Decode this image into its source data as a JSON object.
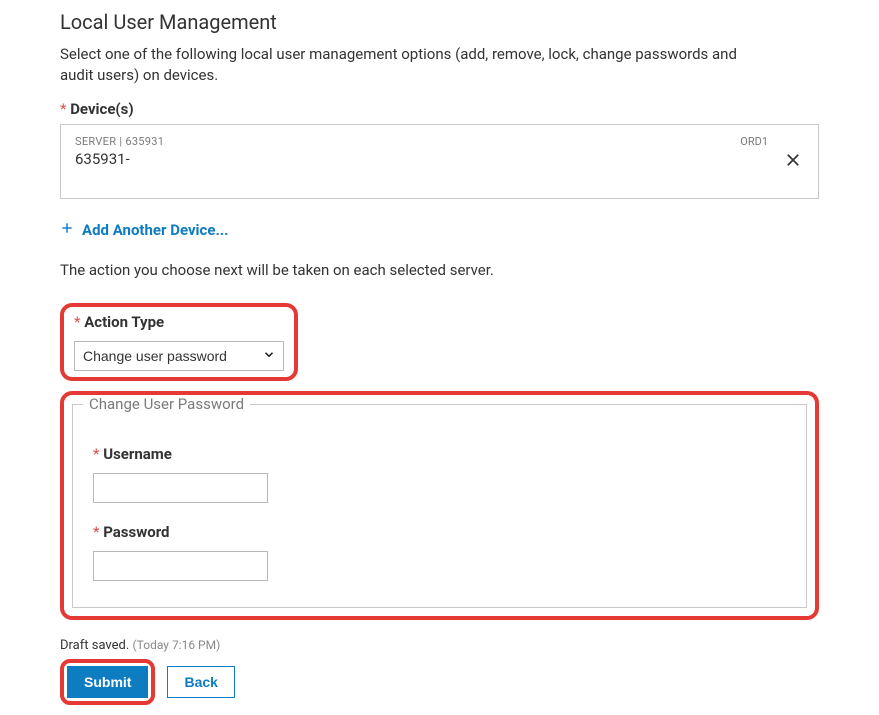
{
  "page": {
    "title": "Local User Management",
    "description": "Select one of the following local user management options (add, remove, lock, change passwords and audit users) on devices."
  },
  "devices": {
    "label": "Device(s)",
    "item": {
      "meta": "SERVER | 635931",
      "name": "635931-",
      "region": "ORD1"
    },
    "add_label": "Add Another Device..."
  },
  "action": {
    "note": "The action you choose next will be taken on each selected server.",
    "label": "Action Type",
    "selected": "Change user password"
  },
  "change_password": {
    "legend": "Change User Password",
    "username_label": "Username",
    "username_value": "",
    "password_label": "Password",
    "password_value": ""
  },
  "footer": {
    "draft_text": "Draft saved.",
    "draft_time": "(Today 7:16 PM)",
    "submit_label": "Submit",
    "back_label": "Back"
  }
}
